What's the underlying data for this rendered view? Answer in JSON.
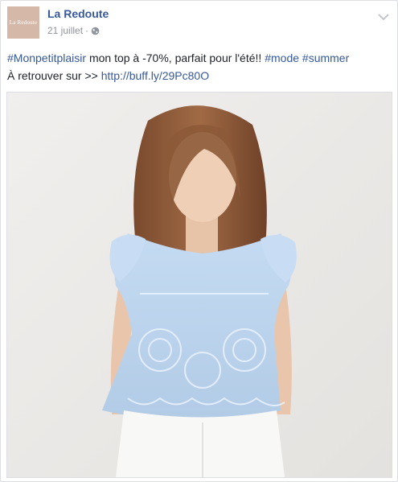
{
  "post": {
    "page_name": "La Redoute",
    "avatar_text": "La Redoute",
    "date": "21 juillet",
    "separator": "·",
    "privacy_icon": "globe-icon",
    "menu_icon": "chevron-down-icon",
    "text": {
      "hashtag_1": "#Monpetitplaisir",
      "body_1": " mon top à -70%, parfait pour l'été!! ",
      "hashtag_2": "#mode",
      "space": " ",
      "hashtag_3": "#summer",
      "body_2": "À retrouver sur >> ",
      "link": "http://buff.ly/29Pc80O"
    }
  },
  "colors": {
    "link": "#365899",
    "text": "#1d2129",
    "meta": "#90949c",
    "blouse": "#b9d3ee",
    "hair": "#8a5a3c"
  }
}
